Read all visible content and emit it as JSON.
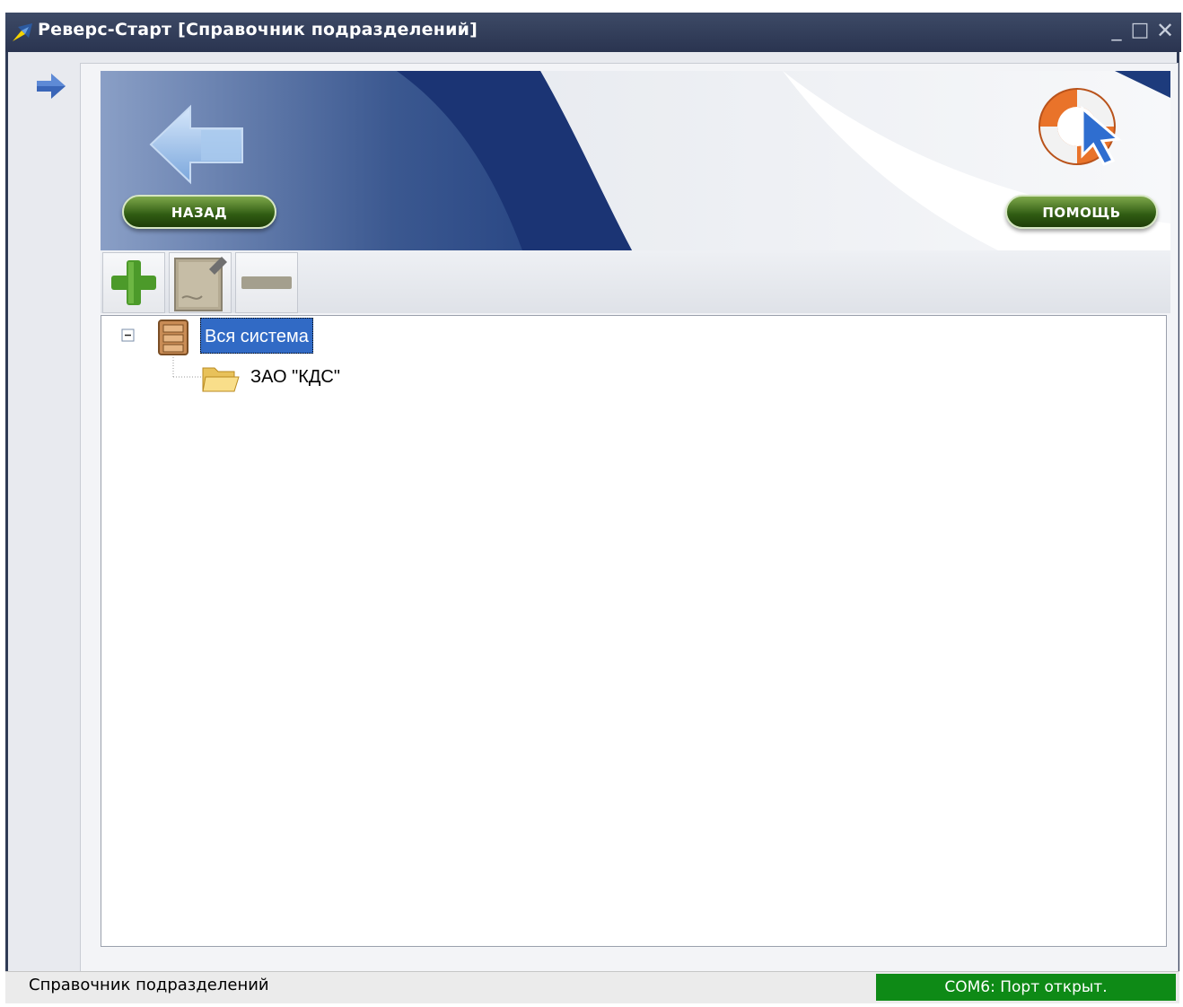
{
  "window": {
    "title": "Реверс-Старт  [Справочник подразделений]",
    "controls": {
      "minimize": "_",
      "maximize": "□",
      "close": "✕"
    }
  },
  "banner": {
    "back_label": "НАЗАД",
    "help_label": "ПОМОЩЬ"
  },
  "toolbar": {
    "buttons": [
      {
        "name": "add",
        "icon": "plus-icon"
      },
      {
        "name": "edit",
        "icon": "edit-document-icon"
      },
      {
        "name": "delete",
        "icon": "minus-icon"
      }
    ]
  },
  "tree": {
    "root": {
      "label": "Вся система",
      "icon": "cabinet-icon",
      "expanded": true,
      "selected": true
    },
    "children": [
      {
        "label": "ЗАО \"КДС\"",
        "icon": "folder-icon"
      }
    ]
  },
  "statusbar": {
    "left": "Справочник подразделений",
    "right": "COM6: Порт открыт."
  },
  "colors": {
    "titlebar": "#2f3a55",
    "selection": "#316ac5",
    "status_ok": "#0e8a16",
    "button_green": "#2f5b12"
  }
}
